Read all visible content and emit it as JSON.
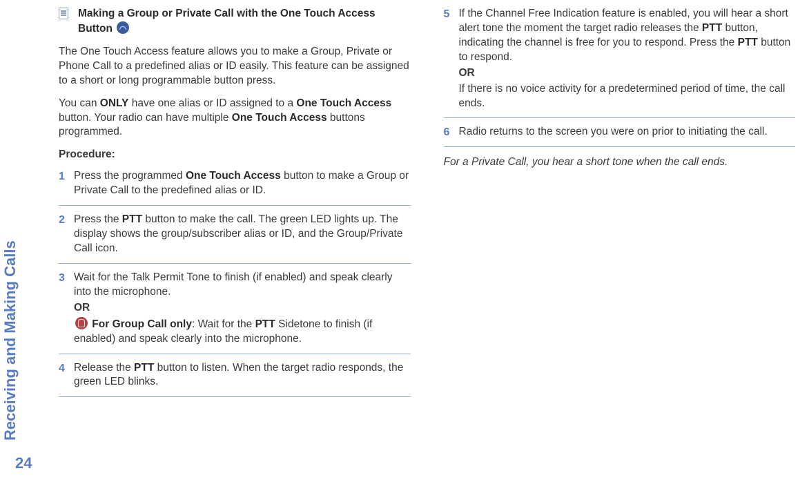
{
  "sidebar": {
    "chapter": "Receiving and Making Calls",
    "page": "24"
  },
  "heading": {
    "title_part1": "Making a Group or Private Call with the One Touch Access Button "
  },
  "intro1_a": "The One Touch Access feature allows you to make a Group, Private or Phone Call to a predefined alias or ID easily. This feature can be assigned to a short or long programmable button press.",
  "intro2_a": "You can ",
  "intro2_b": "ONLY",
  "intro2_c": " have one alias or ID assigned to a ",
  "intro2_d": "One Touch Access",
  "intro2_e": " button. Your radio can have multiple ",
  "intro2_f": "One Touch Access",
  "intro2_g": " buttons programmed.",
  "procedure_label": "Procedure:",
  "steps": {
    "s1_a": "Press the programmed ",
    "s1_b": "One Touch Access",
    "s1_c": " button to make a Group or Private Call to the predefined alias or ID.",
    "s2_a": "Press the ",
    "s2_b": "PTT",
    "s2_c": " button to make the call. The green LED lights up. The display shows the group/subscriber alias or ID, and the Group/Private Call icon.",
    "s3_a": "Wait for the Talk Permit Tone to finish (if enabled) and speak clearly into the microphone.",
    "s3_or": "OR",
    "s3_b1": " For Group Call only",
    "s3_b2": ": Wait for the ",
    "s3_b3": "PTT",
    "s3_b4": " Sidetone to finish (if enabled) and speak clearly into the microphone.",
    "s4_a": "Release the ",
    "s4_b": "PTT",
    "s4_c": " button to listen. When the target radio responds, the green LED blinks.",
    "s5_a": "If the Channel Free Indication feature is enabled, you will hear a short alert tone the moment the target radio releases the ",
    "s5_b": "PTT",
    "s5_c": " button, indicating the channel is free for you to respond. Press the ",
    "s5_d": "PTT",
    "s5_e": " button to respond.",
    "s5_or": "OR",
    "s5_f": "If there is no voice activity for a predetermined period of time, the call ends.",
    "s6_a": "Radio returns to the screen you were on prior to initiating the call."
  },
  "note": "For a Private Call, you hear a short tone when the call ends."
}
